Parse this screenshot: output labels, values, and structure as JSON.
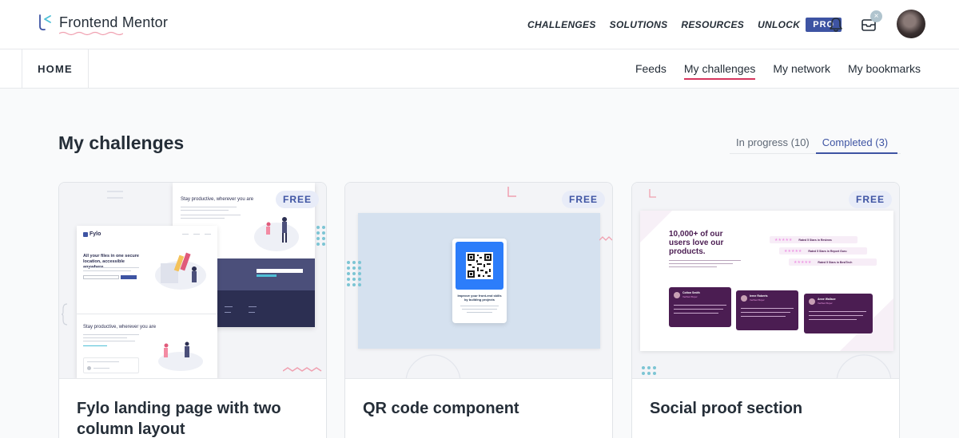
{
  "header": {
    "brand": "Frontend Mentor",
    "nav": [
      "CHALLENGES",
      "SOLUTIONS",
      "RESOURCES",
      "UNLOCK"
    ],
    "pro_badge": "PRO",
    "notification_count": "×"
  },
  "subnav": {
    "home": "HOME",
    "links": [
      "Feeds",
      "My challenges",
      "My network",
      "My bookmarks"
    ],
    "active": "My challenges"
  },
  "page": {
    "title": "My challenges",
    "tabs": [
      "In progress (10)",
      "Completed (3)"
    ],
    "active_tab": "Completed (3)"
  },
  "cards": [
    {
      "badge": "FREE",
      "title": "Fylo landing page with two column layout",
      "preview": {
        "headline_top": "Stay productive, wherever you are",
        "logo": "Fylo",
        "headline_main": "All your files in one secure location, accessible anywhere.",
        "headline_bottom": "Stay productive, wherever you are"
      }
    },
    {
      "badge": "FREE",
      "title": "QR code component",
      "preview": {
        "card_title": "Improve your front-end skills by building projects"
      }
    },
    {
      "badge": "FREE",
      "title": "Social proof section",
      "preview": {
        "heading": "10,000+ of our users love our products.",
        "ratings": [
          "Rated 5 Stars in Reviews",
          "Rated 5 Stars in Report Guru",
          "Rated 5 Stars in BestTech"
        ],
        "reviewers": [
          {
            "name": "Colton Smith",
            "role": "Verified Buyer"
          },
          {
            "name": "Irene Roberts",
            "role": "Verified Buyer"
          },
          {
            "name": "Anne Wallace",
            "role": "Verified Buyer"
          }
        ]
      }
    }
  ],
  "colors": {
    "primary": "#3e54a3",
    "accent": "#d6355d",
    "text": "#252e38",
    "purple": "#4b1d52"
  }
}
